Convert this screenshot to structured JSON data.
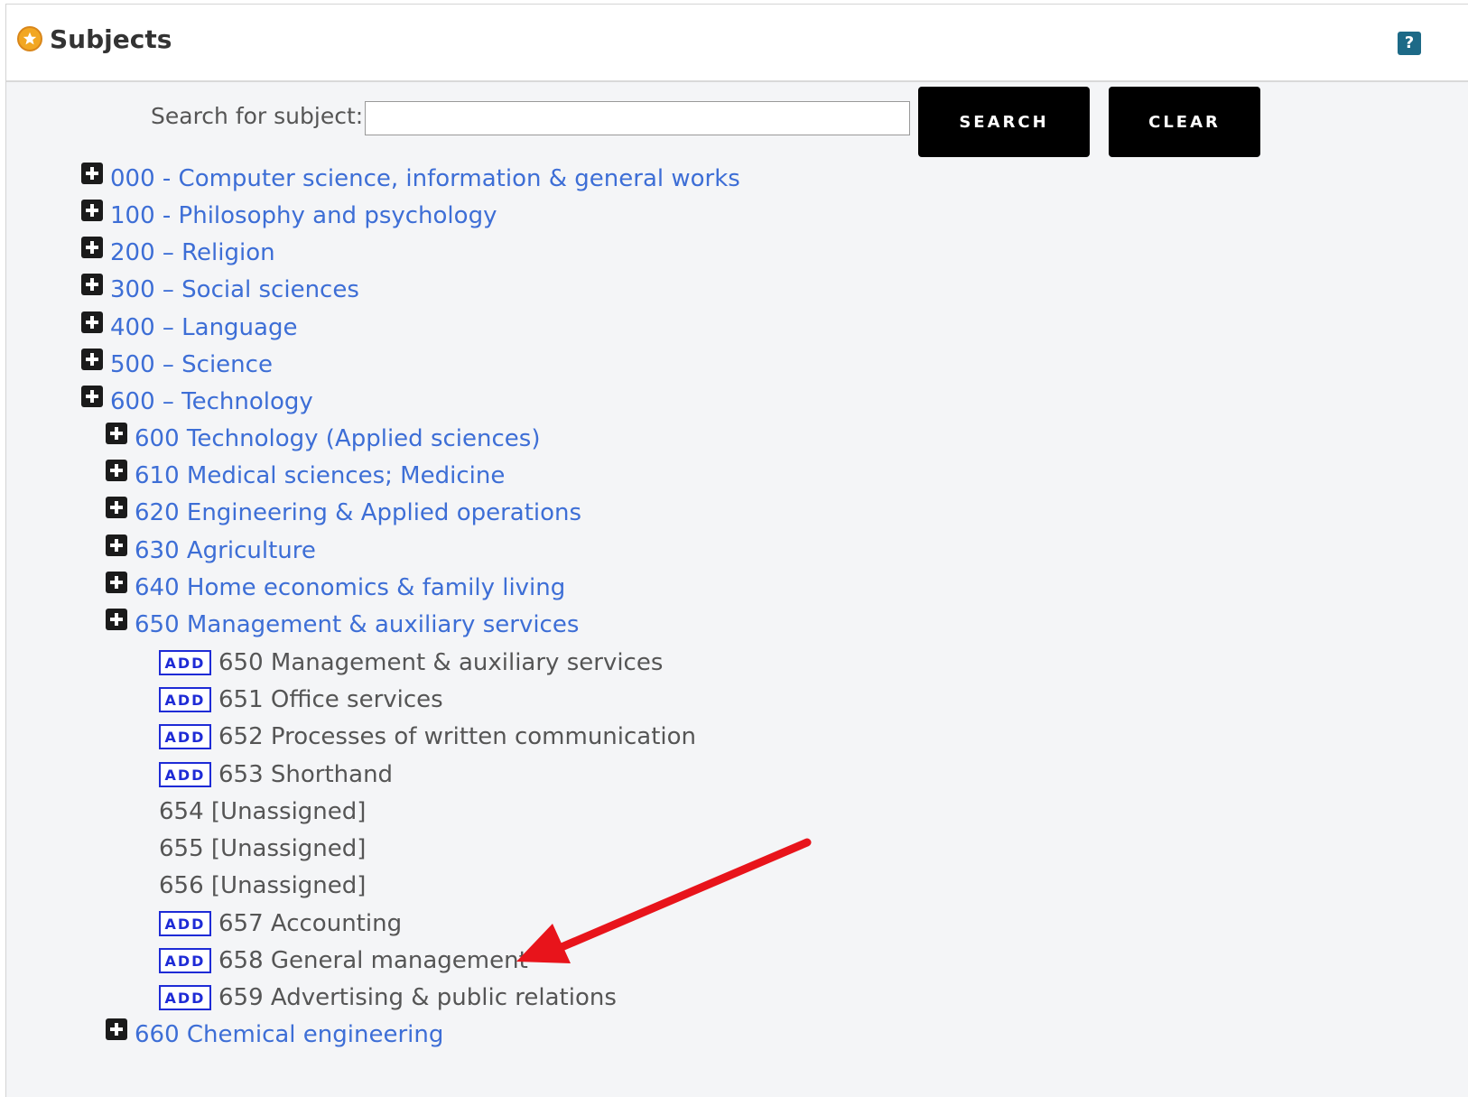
{
  "header": {
    "title": "Subjects",
    "help_label": "?"
  },
  "search": {
    "label": "Search for subject:",
    "value": "",
    "search_button": "SEARCH",
    "clear_button": "CLEAR"
  },
  "tree": {
    "top": [
      "000 - Computer science, information & general works",
      "100 - Philosophy and psychology",
      "200 – Religion",
      "300 – Social sciences",
      "400 – Language",
      "500 – Science",
      "600 – Technology"
    ],
    "sub": [
      "600 Technology (Applied sciences)",
      "610 Medical sciences; Medicine",
      "620 Engineering & Applied operations",
      "630 Agriculture",
      "640 Home economics & family living",
      "650 Management & auxiliary services"
    ],
    "add_label": "ADD",
    "leaves": [
      "650 Management & auxiliary services",
      "651 Office services",
      "652 Processes of written communication",
      "653 Shorthand",
      "654 [Unassigned]",
      "655 [Unassigned]",
      "656 [Unassigned]",
      "657 Accounting",
      "658 General management",
      "659 Advertising & public relations"
    ],
    "after": [
      "660 Chemical engineering"
    ]
  },
  "colors": {
    "link": "#3d6ed6",
    "add_badge": "#1e2bd6",
    "arrow": "#e8141b"
  }
}
